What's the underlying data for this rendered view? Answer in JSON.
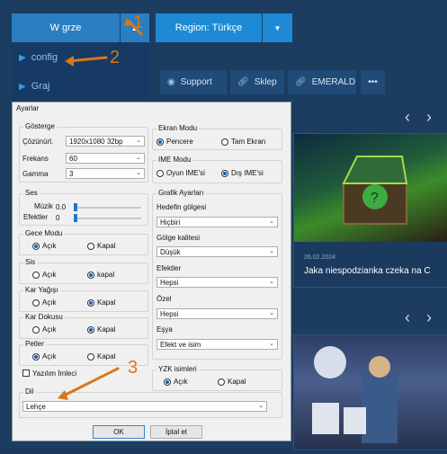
{
  "top": {
    "lang_button": "W grze",
    "region_button": "Region: Türkçe"
  },
  "dropdown": {
    "items": [
      "config",
      "Graj"
    ]
  },
  "nav": {
    "support": "Support",
    "shop": "Sklep",
    "emerald": "EMERALD",
    "more": "•••"
  },
  "news": {
    "date": "26.02.2024",
    "title": "Jaka niespodzianka czeka na C"
  },
  "annotations": [
    "1",
    "2",
    "3"
  ],
  "dialog": {
    "title": "Ayarlar",
    "display": {
      "title": "Gösterge",
      "res_label": "Çözünürl.",
      "res_value": "1920x1080 32bp",
      "freq_label": "Frekans",
      "freq_value": "60",
      "gamma_label": "Gamma",
      "gamma_value": "3"
    },
    "screen_mode": {
      "title": "Ekran Modu",
      "opt1": "Pencere",
      "opt2": "Tam Ekran"
    },
    "ime_mode": {
      "title": "IME Modu",
      "opt1": "Oyun IME'si",
      "opt2": "Dış IME'si"
    },
    "sound": {
      "title": "Ses",
      "music_label": "Müzik",
      "music_value": "0.0",
      "effects_label": "Efektler",
      "effects_value": "0"
    },
    "night_mode": {
      "title": "Gece Modu",
      "on": "Açık",
      "off": "Kapal"
    },
    "fog": {
      "title": "Sis",
      "on": "Açık",
      "off": "kapal"
    },
    "snow_rain": {
      "title": "Kar Yağışı",
      "on": "Açık",
      "off": "Kapal"
    },
    "snow_texture": {
      "title": "Kar Dokusu",
      "on": "Açık",
      "off": "Kapal"
    },
    "pets": {
      "title": "Petler",
      "on": "Açık",
      "off": "Kapal"
    },
    "cursor_label": "Yazılım İmleci",
    "graphics": {
      "title": "Grafik Ayarları",
      "target_shadow_label": "Hedefin gölgesi",
      "target_shadow_value": "Hiçbiri",
      "shadow_quality_label": "Gölge kalitesi",
      "shadow_quality_value": "Düşük",
      "effects_label": "Efektler",
      "effects_value": "Hepsi",
      "special_label": "Özel",
      "special_value": "Hepsi",
      "items_label": "Eşya",
      "items_value": "Efekt ve isim"
    },
    "yzk": {
      "title": "YZK isimleri",
      "on": "Açık",
      "off": "Kapal"
    },
    "language": {
      "title": "Dil",
      "value": "Lehçe"
    },
    "ok": "OK",
    "cancel": "İptal et"
  },
  "colors": {
    "accent": "#1e8ad6",
    "annotation": "#d97716",
    "background": "#1d3d60"
  }
}
